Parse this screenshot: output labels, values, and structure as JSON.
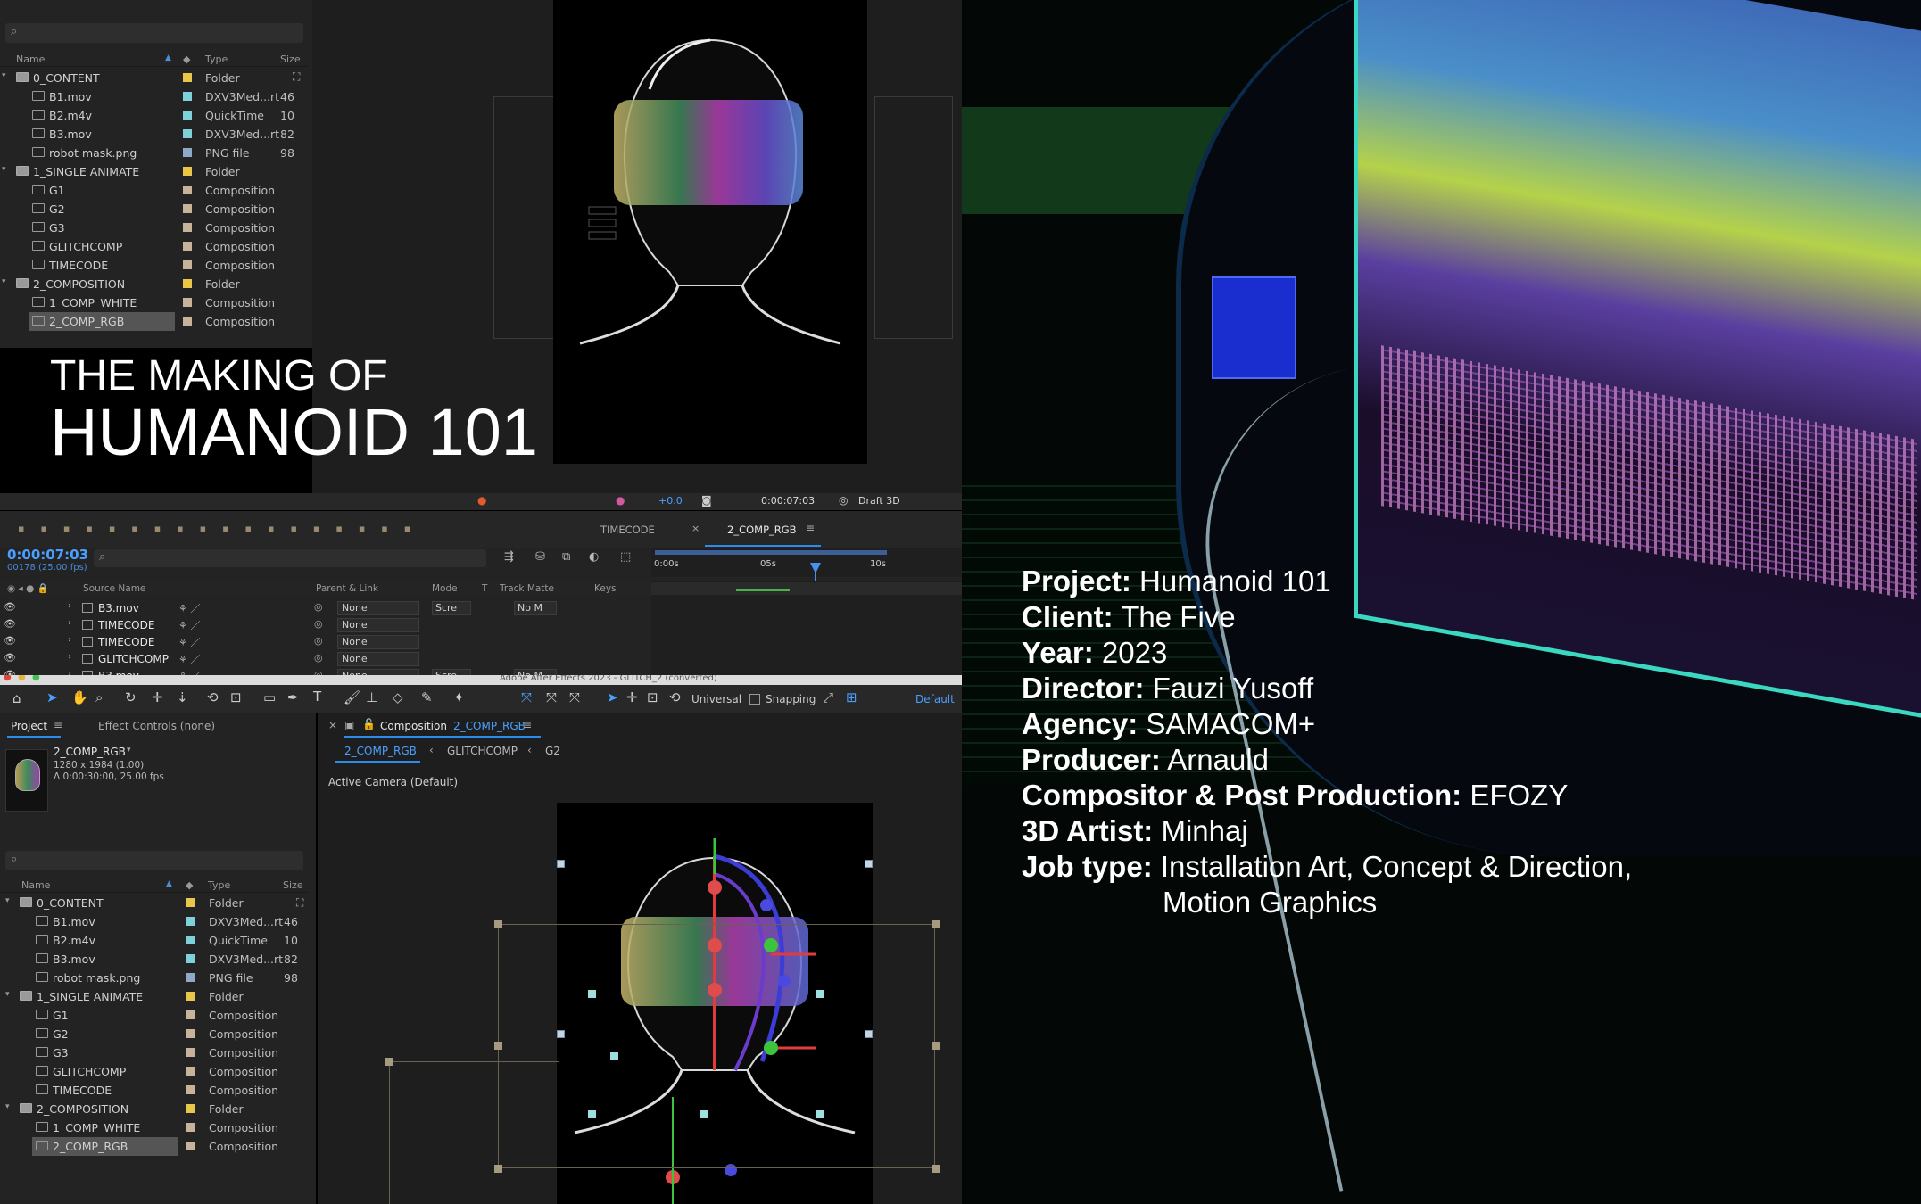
{
  "project_panel_top": {
    "columns": {
      "name": "Name",
      "type": "Type",
      "size": "Size"
    },
    "items": [
      {
        "name": "0_CONTENT",
        "type": "Folder",
        "size": "",
        "kind": "folder",
        "level": 0,
        "color": "#e8c64a"
      },
      {
        "name": "B1.mov",
        "type": "DXV3Med...rt",
        "size": "46",
        "kind": "file",
        "level": 1,
        "color": "#7fd1d9"
      },
      {
        "name": "B2.m4v",
        "type": "QuickTime",
        "size": "10",
        "kind": "file",
        "level": 1,
        "color": "#7fd1d9"
      },
      {
        "name": "B3.mov",
        "type": "DXV3Med...rt",
        "size": "82",
        "kind": "file",
        "level": 1,
        "color": "#7fd1d9"
      },
      {
        "name": "robot mask.png",
        "type": "PNG file",
        "size": "98",
        "kind": "file",
        "level": 1,
        "color": "#8fa8c8"
      },
      {
        "name": "1_SINGLE ANIMATE",
        "type": "Folder",
        "size": "",
        "kind": "folder",
        "level": 0,
        "color": "#e8c64a"
      },
      {
        "name": "G1",
        "type": "Composition",
        "size": "",
        "kind": "comp",
        "level": 1,
        "color": "#c7b29a"
      },
      {
        "name": "G2",
        "type": "Composition",
        "size": "",
        "kind": "comp",
        "level": 1,
        "color": "#c7b29a"
      },
      {
        "name": "G3",
        "type": "Composition",
        "size": "",
        "kind": "comp",
        "level": 1,
        "color": "#c7b29a"
      },
      {
        "name": "GLITCHCOMP",
        "type": "Composition",
        "size": "",
        "kind": "comp",
        "level": 1,
        "color": "#c7b29a"
      },
      {
        "name": "TIMECODE",
        "type": "Composition",
        "size": "",
        "kind": "comp",
        "level": 1,
        "color": "#c7b29a"
      },
      {
        "name": "2_COMPOSITION",
        "type": "Folder",
        "size": "",
        "kind": "folder",
        "level": 0,
        "color": "#e8c64a"
      },
      {
        "name": "1_COMP_WHITE",
        "type": "Composition",
        "size": "",
        "kind": "comp",
        "level": 1,
        "color": "#c7b29a"
      },
      {
        "name": "2_COMP_RGB",
        "type": "Composition",
        "size": "",
        "kind": "comp",
        "level": 1,
        "color": "#c7b29a",
        "selected": true
      }
    ]
  },
  "overlay_title": {
    "line1": "THE MAKING OF",
    "line2": "HUMANOID 101"
  },
  "viewer_top": {
    "timecode": "0:00:07:03",
    "renderer": "Draft 3D",
    "exposure": "+0.0"
  },
  "timeline": {
    "current_time": "0:00:07:03",
    "frame_info": "00178 (25.00 fps)",
    "tabs": [
      "TIMECODE",
      "2_COMP_RGB"
    ],
    "columns": {
      "source_name": "Source Name",
      "parent_link": "Parent & Link",
      "mode": "Mode",
      "t": "T",
      "track_matte": "Track Matte",
      "keys": "Keys"
    },
    "ruler": [
      "0:00s",
      "05s",
      "10s"
    ],
    "layers": [
      {
        "name": "B3.mov",
        "parent": "None",
        "mode": "Scre",
        "matte": "No M"
      },
      {
        "name": "TIMECODE",
        "parent": "None",
        "mode": "",
        "matte": ""
      },
      {
        "name": "TIMECODE",
        "parent": "None",
        "mode": "",
        "matte": ""
      },
      {
        "name": "GLITCHCOMP",
        "parent": "None",
        "mode": "",
        "matte": ""
      },
      {
        "name": "B3.mov",
        "parent": "None",
        "mode": "Scre",
        "matte": "No M"
      }
    ]
  },
  "window_title": "Adobe After Effects 2023 - GLITCH_2 (converted)",
  "tools_bar": {
    "universal": "Universal",
    "snapping": "Snapping",
    "workspace": "Default"
  },
  "project_panel_bottom": {
    "tab_project": "Project",
    "tab_effects": "Effect Controls (none)",
    "selected_comp": {
      "name": "2_COMP_RGB",
      "size": "1280 x 1984 (1.00)",
      "duration": "Δ 0:00:30:00, 25.00 fps"
    }
  },
  "comp_viewer": {
    "tab_label": "Composition",
    "tab_comp": "2_COMP_RGB",
    "breadcrumb": [
      "2_COMP_RGB",
      "GLITCHCOMP",
      "G2"
    ],
    "camera": "Active Camera (Default)"
  },
  "credits": [
    {
      "label": "Project:",
      "value": "Humanoid 101"
    },
    {
      "label": "Client:",
      "value": "The Five"
    },
    {
      "label": "Year:",
      "value": "2023"
    },
    {
      "label": "Director:",
      "value": "Fauzi Yusoff"
    },
    {
      "label": "Agency:",
      "value": "SAMACOM+"
    },
    {
      "label": "Producer:",
      "value": "Arnauld"
    },
    {
      "label": "Compositor & Post Production:",
      "value": "EFOZY"
    },
    {
      "label": "3D Artist:",
      "value": "Minhaj"
    },
    {
      "label": "Job type:",
      "value": "Installation Art, Concept & Direction,",
      "value2": "Motion Graphics"
    }
  ]
}
